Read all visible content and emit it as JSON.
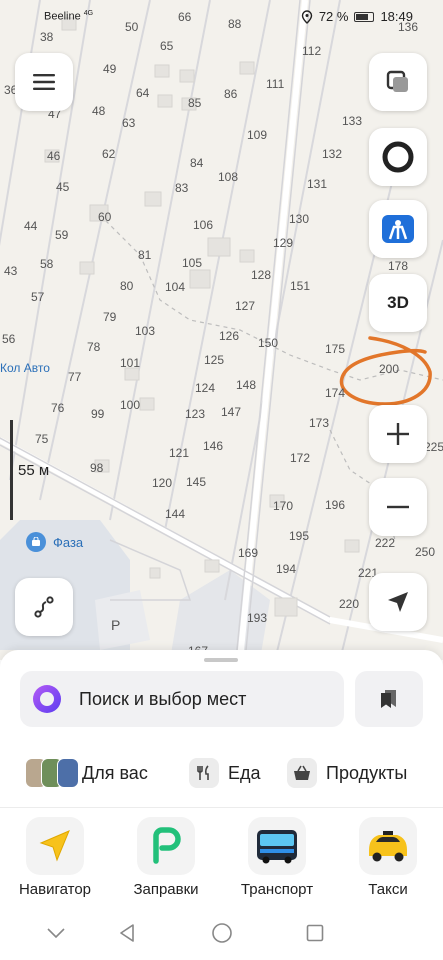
{
  "status_bar": {
    "carrier": "Beeline",
    "network": "4G",
    "battery_percent": "72 %",
    "battery_level": 0.72,
    "time": "18:49"
  },
  "map": {
    "house_numbers": [
      "38",
      "50",
      "66",
      "88",
      "36",
      "112",
      "136",
      "49",
      "65",
      "85",
      "111",
      "47",
      "48",
      "64",
      "86",
      "63",
      "133",
      "62",
      "109",
      "46",
      "132",
      "84",
      "131",
      "45",
      "83",
      "108",
      "106",
      "130",
      "60",
      "44",
      "59",
      "129",
      "178",
      "105",
      "81",
      "151",
      "58",
      "80",
      "104",
      "128",
      "43",
      "57",
      "79",
      "127",
      "103",
      "126",
      "150",
      "56",
      "78",
      "175",
      "125",
      "101",
      "77",
      "124",
      "148",
      "200",
      "100",
      "174",
      "123",
      "147",
      "76",
      "99",
      "173",
      "75",
      "121",
      "146",
      "172",
      "98",
      "120",
      "145",
      "225",
      "170",
      "196",
      "144",
      "195",
      "169",
      "250",
      "222",
      "194",
      "221",
      "193",
      "220",
      "167"
    ],
    "road_label": "Р",
    "poi_kol_avto": "Кол Авто",
    "poi_faza": "Фаза",
    "scale_label": "55 м"
  },
  "controls": {
    "menu_icon": "hamburger-icon",
    "layers_icon": "layers-icon",
    "alice_icon": "alice-icon",
    "guide_icon": "guide-icon",
    "three_d_label": "3D",
    "zoom_in_icon": "plus-icon",
    "zoom_out_icon": "minus-icon",
    "location_icon": "navigation-arrow-icon",
    "route_icon": "route-icon"
  },
  "sheet": {
    "search_placeholder": "Поиск и выбор мест",
    "categories": [
      {
        "label": "Для вас",
        "icon": "photos-icon"
      },
      {
        "label": "Еда",
        "icon": "fork-knife-icon"
      },
      {
        "label": "Продукты",
        "icon": "basket-icon"
      }
    ],
    "apps": [
      {
        "label": "Навигатор",
        "icon": "navigator-icon"
      },
      {
        "label": "Заправки",
        "icon": "fuel-icon"
      },
      {
        "label": "Транспорт",
        "icon": "bus-icon"
      },
      {
        "label": "Такси",
        "icon": "taxi-icon"
      }
    ]
  },
  "colors": {
    "accent_orange": "#e2762a",
    "map_background": "#f3f1ec",
    "alice_purple": "#7d3cf5",
    "guide_blue": "#1f6fd9",
    "poi_blue": "#2a6fb8"
  }
}
